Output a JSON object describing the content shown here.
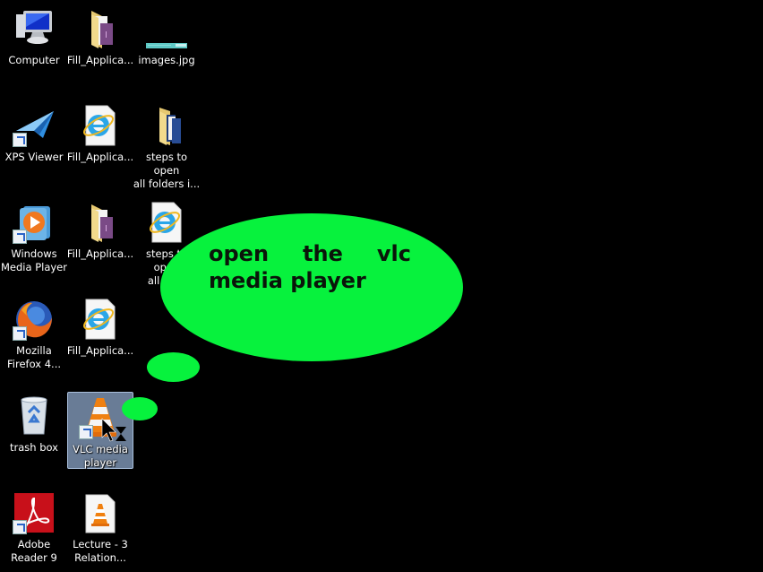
{
  "desktop": {
    "icons": [
      {
        "label": "Computer",
        "icon": "computer-icon"
      },
      {
        "label": "Fill_Applica...",
        "icon": "folder-icon"
      },
      {
        "label": "images.jpg",
        "icon": "image-file-icon"
      },
      {
        "label": "XPS Viewer",
        "icon": "xps-viewer-icon"
      },
      {
        "label": "Fill_Applica...",
        "icon": "internet-explorer-file-icon"
      },
      {
        "label": "steps to open\nall folders i...",
        "icon": "folder-icon"
      },
      {
        "label": "Windows\nMedia Player",
        "icon": "windows-media-player-icon"
      },
      {
        "label": "Fill_Applica...",
        "icon": "folder-icon"
      },
      {
        "label": "steps to open\nall fol...",
        "icon": "internet-explorer-file-icon"
      },
      {
        "label": "Mozilla\nFirefox 4...",
        "icon": "firefox-icon"
      },
      {
        "label": "Fill_Applica...",
        "icon": "internet-explorer-file-icon"
      },
      {
        "label": "trash box",
        "icon": "recycle-bin-icon"
      },
      {
        "label": "VLC media\nplayer",
        "icon": "vlc-icon",
        "selected": true
      },
      {
        "label": "Adobe\nReader 9",
        "icon": "adobe-reader-icon"
      },
      {
        "label": "Lecture - 3\nRelation...",
        "icon": "vlc-file-icon"
      }
    ]
  },
  "callout": {
    "text": "open the vlc media player",
    "color": "#07f23d"
  }
}
